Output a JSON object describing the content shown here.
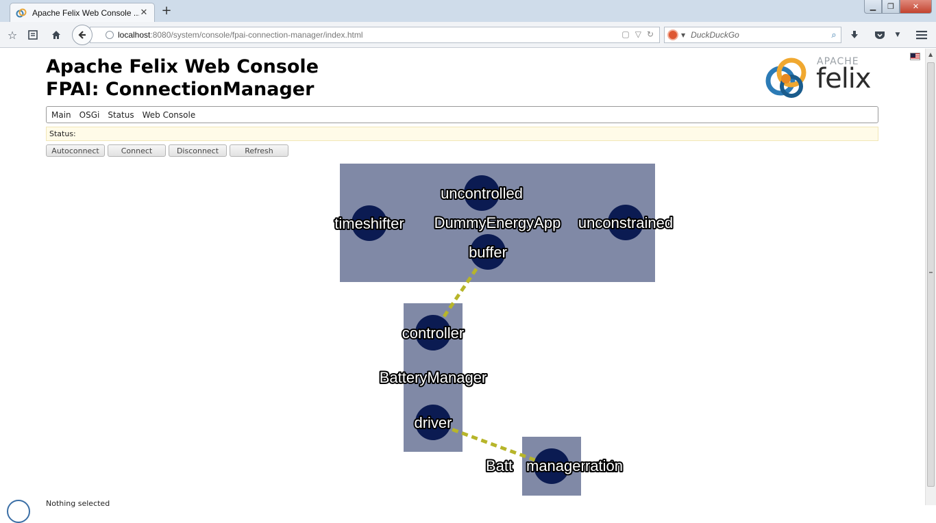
{
  "browser": {
    "tab_title": "Apache Felix Web Console ...",
    "tab_close": "✕",
    "new_tab": "+",
    "url_host": "localhost",
    "url_path": ":8080/system/console/fpai-connection-manager/index.html",
    "search_placeholder": "DuckDuckGo",
    "window_buttons": {
      "minimize": "▁",
      "maximize": "❐",
      "close": "✕"
    }
  },
  "header": {
    "line1": "Apache Felix Web Console",
    "line2": "FPAI: ConnectionManager",
    "logo_small": "APACHE",
    "logo_large": "felix"
  },
  "menu": {
    "items": [
      "Main",
      "OSGi",
      "Status",
      "Web Console"
    ]
  },
  "status": {
    "label": "Status:"
  },
  "buttons": {
    "autoconnect": "Autoconnect",
    "connect": "Connect",
    "disconnect": "Disconnect",
    "refresh": "Refresh"
  },
  "graph": {
    "colors": {
      "container": "#8089a6",
      "port": "#0b1b52",
      "edge": "#b7b52a"
    },
    "containers": {
      "dummy": "DummyEnergyApp",
      "battery": "BatteryManager",
      "batt": "Batt",
      "batt_overlap": "management"
    },
    "ports": {
      "uncontrolled": "uncontrolled",
      "timeshifter": "timeshifter",
      "unconstrained": "unconstrained",
      "buffer": "buffer",
      "controller": "controller",
      "driver": "driver",
      "batt_port_suffix": "ration"
    }
  },
  "footer": {
    "selection": "Nothing selected"
  }
}
